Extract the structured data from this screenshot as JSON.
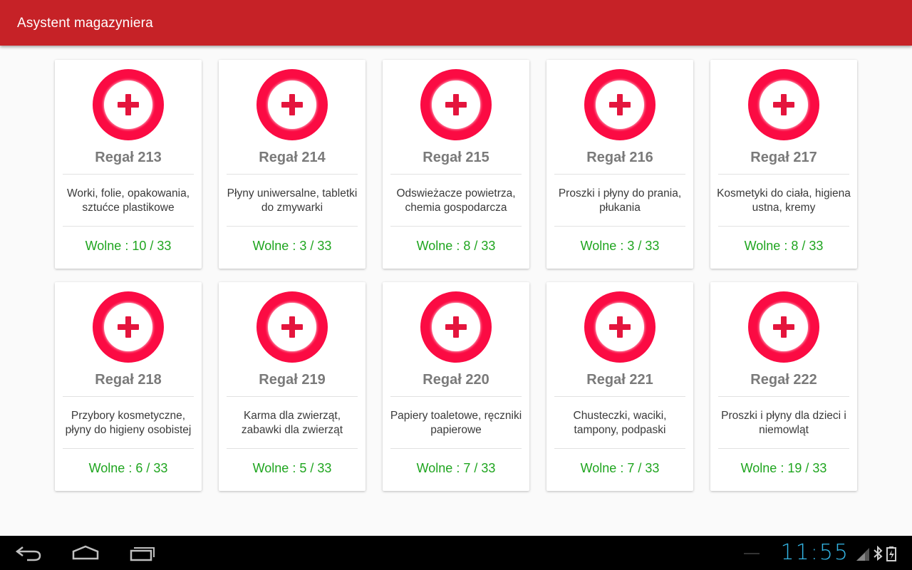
{
  "app": {
    "title": "Asystent magazyniera"
  },
  "colors": {
    "appbar": "#c62227",
    "badge": "#fb0b43",
    "free_text": "#1fa51f",
    "clock": "#33b5e5"
  },
  "shelves": [
    {
      "name": "Regał 213",
      "desc_l1": "Worki, folie, opakowania,",
      "desc_l2": "sztućce plastikowe",
      "free": "Wolne : 10 / 33"
    },
    {
      "name": "Regał 214",
      "desc_l1": "Płyny uniwersalne, tabletki",
      "desc_l2": "do zmywarki",
      "free": "Wolne : 3 / 33"
    },
    {
      "name": "Regał 215",
      "desc_l1": "Odswieżacze powietrza,",
      "desc_l2": "chemia gospodarcza",
      "free": "Wolne : 8 / 33"
    },
    {
      "name": "Regał 216",
      "desc_l1": "Proszki i płyny do prania,",
      "desc_l2": "płukania",
      "free": "Wolne : 3 / 33"
    },
    {
      "name": "Regał 217",
      "desc_l1": "Kosmetyki do ciała, higiena",
      "desc_l2": "ustna, kremy",
      "free": "Wolne : 8 / 33"
    },
    {
      "name": "Regał 218",
      "desc_l1": "Przybory kosmetyczne,",
      "desc_l2": "płyny do higieny osobistej",
      "free": "Wolne : 6 / 33"
    },
    {
      "name": "Regał 219",
      "desc_l1": "Karma dla zwierząt,",
      "desc_l2": "zabawki dla zwierząt",
      "free": "Wolne : 5 / 33"
    },
    {
      "name": "Regał 220",
      "desc_l1": "Papiery toaletowe, ręczniki",
      "desc_l2": "papierowe",
      "free": "Wolne : 7 / 33"
    },
    {
      "name": "Regał 221",
      "desc_l1": "Chusteczki, waciki,",
      "desc_l2": "tampony, podpaski",
      "free": "Wolne : 7 / 33"
    },
    {
      "name": "Regał 222",
      "desc_l1": "Proszki i płyny dla dzieci i",
      "desc_l2": "niemowląt",
      "free": "Wolne : 19 / 33"
    }
  ],
  "system_bar": {
    "clock": "11:55",
    "back_icon": "back-arrow-icon",
    "home_icon": "home-icon",
    "recents_icon": "recent-apps-icon"
  }
}
